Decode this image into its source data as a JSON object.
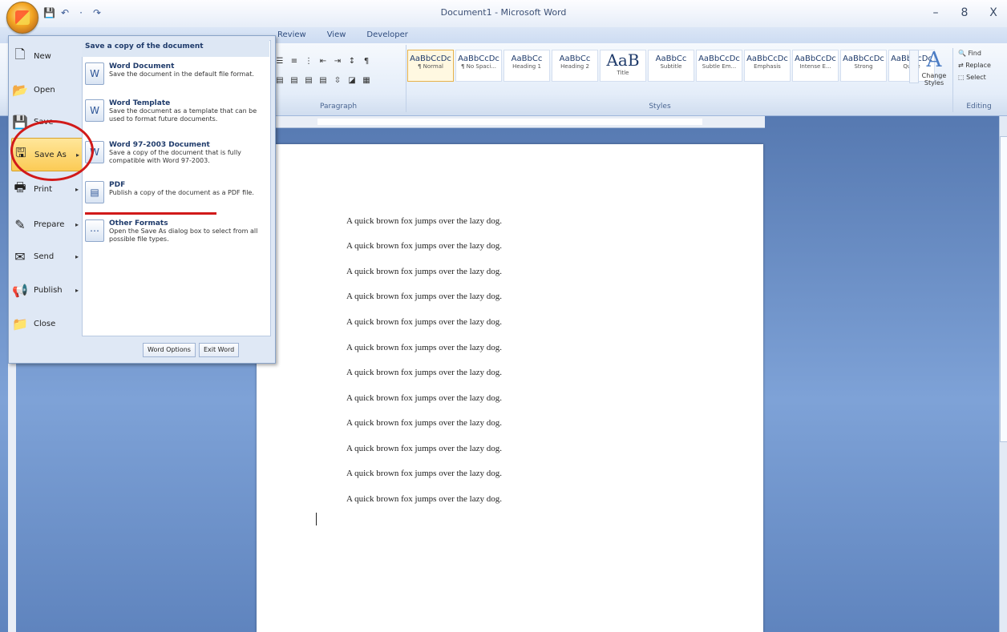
{
  "window": {
    "title": "Document1 - Microsoft Word",
    "controls": [
      "–",
      "8",
      "X"
    ]
  },
  "qat": [
    "💾",
    "↶",
    "·",
    "↷"
  ],
  "tabs": [
    "Review",
    "View",
    "Developer"
  ],
  "paragraph_group": {
    "label": "Paragraph"
  },
  "styles_group": {
    "label": "Styles",
    "tiles": [
      {
        "sample": "AaBbCcDc",
        "name": "¶ Normal"
      },
      {
        "sample": "AaBbCcDc",
        "name": "¶ No Spaci..."
      },
      {
        "sample": "AaBbCc",
        "name": "Heading 1"
      },
      {
        "sample": "AaBbCc",
        "name": "Heading 2"
      },
      {
        "sample": "AaB",
        "name": "Title"
      },
      {
        "sample": "AaBbCc",
        "name": "Subtitle"
      },
      {
        "sample": "AaBbCcDc",
        "name": "Subtle Em..."
      },
      {
        "sample": "AaBbCcDc",
        "name": "Emphasis"
      },
      {
        "sample": "AaBbCcDc",
        "name": "Intense E..."
      },
      {
        "sample": "AaBbCcDc",
        "name": "Strong"
      },
      {
        "sample": "AaBbCcDc",
        "name": "Quote"
      }
    ],
    "change_styles": "Change Styles"
  },
  "editing_group": {
    "label": "Editing",
    "find": "Find",
    "replace": "Replace",
    "select": "Select"
  },
  "office_menu": {
    "left_items": [
      {
        "label": "New"
      },
      {
        "label": "Open"
      },
      {
        "label": "Save"
      },
      {
        "label": "Save As"
      },
      {
        "label": "Print"
      },
      {
        "label": "Prepare"
      },
      {
        "label": "Send"
      },
      {
        "label": "Publish"
      },
      {
        "label": "Close"
      }
    ],
    "submenu_header": "Save a copy of the document",
    "submenu_items": [
      {
        "title": "Word Document",
        "desc": "Save the document in the default file format."
      },
      {
        "title": "Word Template",
        "desc": "Save the document as a template that can be used to format future documents."
      },
      {
        "title": "Word 97-2003 Document",
        "desc": "Save a copy of the document that is fully compatible with Word 97-2003."
      },
      {
        "title": "PDF",
        "desc": "Publish a copy of the document as a PDF file."
      },
      {
        "title": "Other Formats",
        "desc": "Open the Save As dialog box to select from all possible file types."
      }
    ],
    "word_options": "Word Options",
    "exit_word": "Exit Word"
  },
  "document": {
    "lines": [
      "A quick brown fox jumps over the lazy dog.",
      "A quick brown fox jumps over the lazy dog.",
      "A quick brown fox jumps over the lazy dog.",
      "A quick brown fox jumps over the lazy dog.",
      "A quick brown fox jumps over the lazy dog.",
      "A quick brown fox jumps over the lazy dog.",
      "A quick brown fox jumps over the lazy dog.",
      "A quick brown fox jumps over the lazy dog.",
      "A quick brown fox jumps over the lazy dog.",
      "A quick brown fox jumps over the lazy dog.",
      "A quick brown fox jumps over the lazy dog.",
      "A quick brown fox jumps over the lazy dog."
    ]
  },
  "colors": {
    "annotation_red": "#d11a1a",
    "ribbon_blue": "#d0ddef",
    "workspace_blue": "#6f93c9",
    "highlight_gold": "#fbcb55"
  }
}
